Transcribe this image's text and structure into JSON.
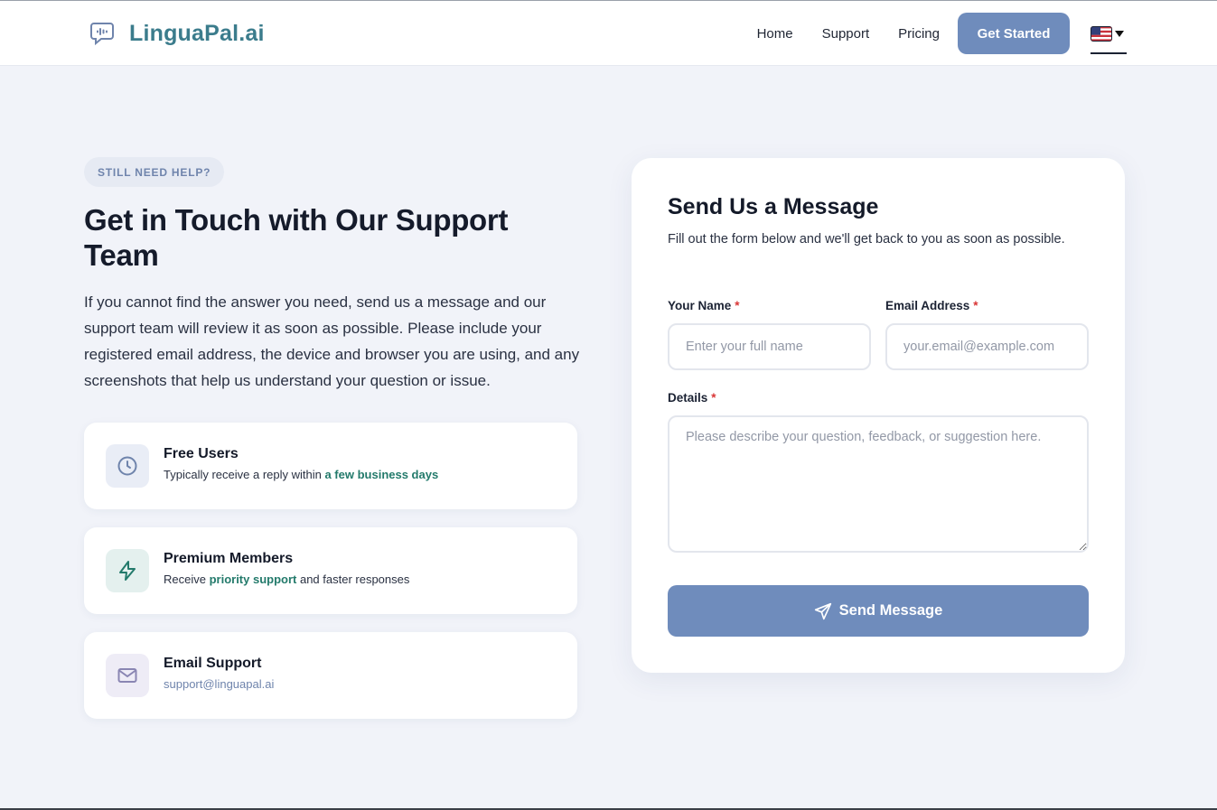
{
  "header": {
    "brand": "LinguaPal.ai",
    "nav": [
      {
        "label": "Home"
      },
      {
        "label": "Support"
      },
      {
        "label": "Pricing"
      }
    ],
    "cta_label": "Get Started",
    "language_icon": "us-flag-icon"
  },
  "contact": {
    "eyebrow": "STILL NEED HELP?",
    "headline": "Get in Touch with Our Support Team",
    "intro": "If you cannot find the answer you need, send us a message and our support team will review it as soon as possible. Please include your registered email address, the device and browser you are using, and any screenshots that help us understand your question or issue.",
    "cards": [
      {
        "icon": "clock-icon",
        "title": "Free Users",
        "desc_prefix": "Typically receive a reply within ",
        "desc_highlight": "a few business days",
        "desc_suffix": ""
      },
      {
        "icon": "lightning-icon",
        "title": "Premium Members",
        "desc_prefix": "Receive ",
        "desc_highlight": "priority support",
        "desc_suffix": " and faster responses"
      },
      {
        "icon": "mail-icon",
        "title": "Email Support",
        "email": "support@linguapal.ai"
      }
    ]
  },
  "form": {
    "title": "Send Us a Message",
    "subtitle": "Fill out the form below and we'll get back to you as soon as possible.",
    "name_label": "Your Name",
    "name_placeholder": "Enter your full name",
    "email_label": "Email Address",
    "email_placeholder": "your.email@example.com",
    "details_label": "Details",
    "details_placeholder": "Please describe your question, feedback, or suggestion here.",
    "required_mark": "*",
    "submit_label": "Send Message"
  },
  "colors": {
    "brand": "#3b7c8c",
    "button": "#6f8cbc",
    "highlight": "#237a6b",
    "required": "#d93636",
    "background": "#f1f3f9"
  }
}
